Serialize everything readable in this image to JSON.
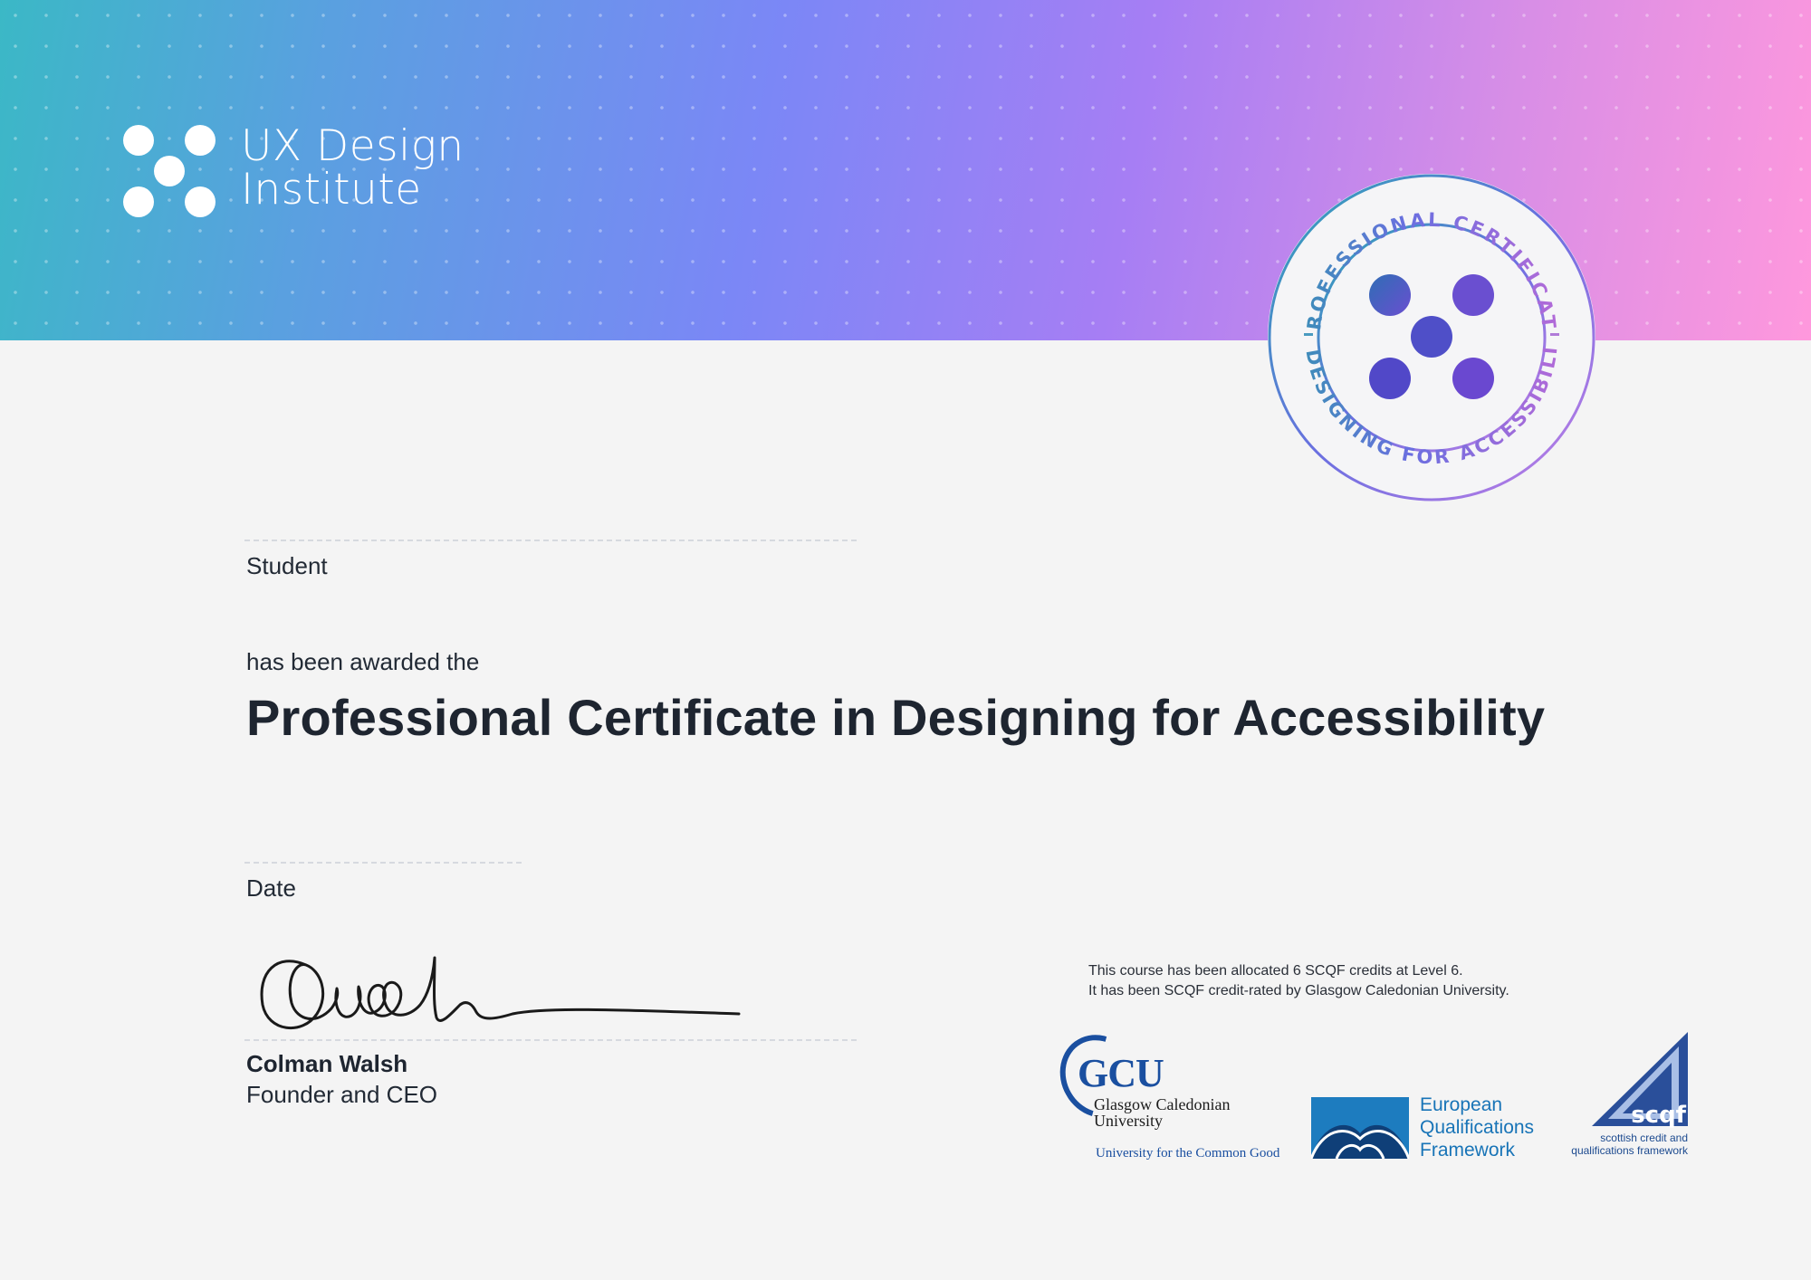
{
  "brand": {
    "line1": "UX Design",
    "line2": "Institute"
  },
  "seal": {
    "top_text": "PROFESSIONAL CERTIFICATE",
    "bottom_text": "IN DESIGNING FOR ACCESSIBILITY"
  },
  "student": {
    "label": "Student"
  },
  "award": {
    "intro": "has been awarded the",
    "title": "Professional Certificate in Designing for Accessibility"
  },
  "date": {
    "label": "Date"
  },
  "signer": {
    "name": "Colman Walsh",
    "title": "Founder and CEO"
  },
  "credits": {
    "line1": "This course has been allocated 6 SCQF credits at Level 6.",
    "line2": "It has been SCQF credit-rated by Glasgow Caledonian University."
  },
  "partners": {
    "gcu": {
      "mark": "GCU",
      "name_line1": "Glasgow Caledonian",
      "name_line2": "University",
      "tagline": "University for the Common Good"
    },
    "eqf": {
      "line1": "European",
      "line2": "Qualifications",
      "line3": "Framework"
    },
    "scqf": {
      "mark": "scqf",
      "line1": "scottish credit and",
      "line2": "qualifications framework"
    }
  },
  "colors": {
    "gradient": [
      "#3bb8c6",
      "#7b87f6",
      "#a67ef4",
      "#ff98dd"
    ],
    "text_dark": "#1e2530",
    "gcu_blue": "#1a4fa0",
    "eqf_blue": "#1874b7"
  }
}
